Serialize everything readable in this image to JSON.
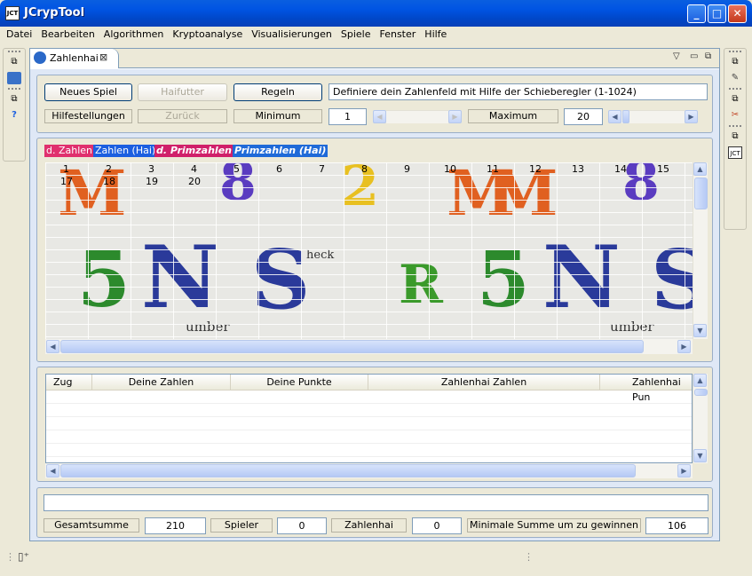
{
  "window": {
    "title": "JCrypTool",
    "icon": "jct-app-icon",
    "minimize": "_",
    "maximize": "□",
    "close": "✕"
  },
  "menu": [
    "Datei",
    "Bearbeiten",
    "Algorithmen",
    "Kryptoanalyse",
    "Visualisierungen",
    "Spiele",
    "Fenster",
    "Hilfe"
  ],
  "editor": {
    "tab_label": "Zahlenhai",
    "tab_close": "⊠"
  },
  "controls": {
    "new_game": "Neues Spiel",
    "shark_food": "Haifutter",
    "rules": "Regeln",
    "instruction": "Definiere dein Zahlenfeld mit Hilfe der Schieberegler (1-1024)",
    "help": "Hilfestellungen",
    "back": "Zurück",
    "minimum_label": "Minimum",
    "minimum_value": "1",
    "maximum_label": "Maximum",
    "maximum_value": "20"
  },
  "legend": {
    "your_numbers": "d. Zahlen",
    "shark_numbers": "Zahlen (Hai)",
    "your_primes": "d. Primzahlen",
    "shark_primes": "Primzahlen (Hai)",
    "colors": {
      "your_numbers": "#e0306e",
      "shark_numbers": "#1c5fe0",
      "your_primes": "#d0206a",
      "shark_primes": "#1f6ad8"
    }
  },
  "board": {
    "numbers": [
      "1",
      "2",
      "3",
      "4",
      "5",
      "6",
      "7",
      "8",
      "9",
      "10",
      "11",
      "12",
      "13",
      "14",
      "15",
      "17",
      "18",
      "19",
      "20"
    ],
    "background_glyphs": [
      "M",
      "8",
      "2",
      "M",
      "M",
      "8",
      "5",
      "N",
      "S",
      "R",
      "5",
      "N",
      "S"
    ],
    "annotation_1": "heck",
    "annotation_2": "umber",
    "annotation_3": "umber"
  },
  "table": {
    "columns": [
      "Zug",
      "Deine Zahlen",
      "Deine Punkte",
      "Zahlenhai Zahlen",
      "Zahlenhai Pun"
    ]
  },
  "scores": {
    "total_label": "Gesamtsumme",
    "total_value": "210",
    "player_label": "Spieler",
    "player_value": "0",
    "shark_label": "Zahlenhai",
    "shark_value": "0",
    "min_win_label": "Minimale Summe um zu gewinnen",
    "min_win_value": "106"
  }
}
